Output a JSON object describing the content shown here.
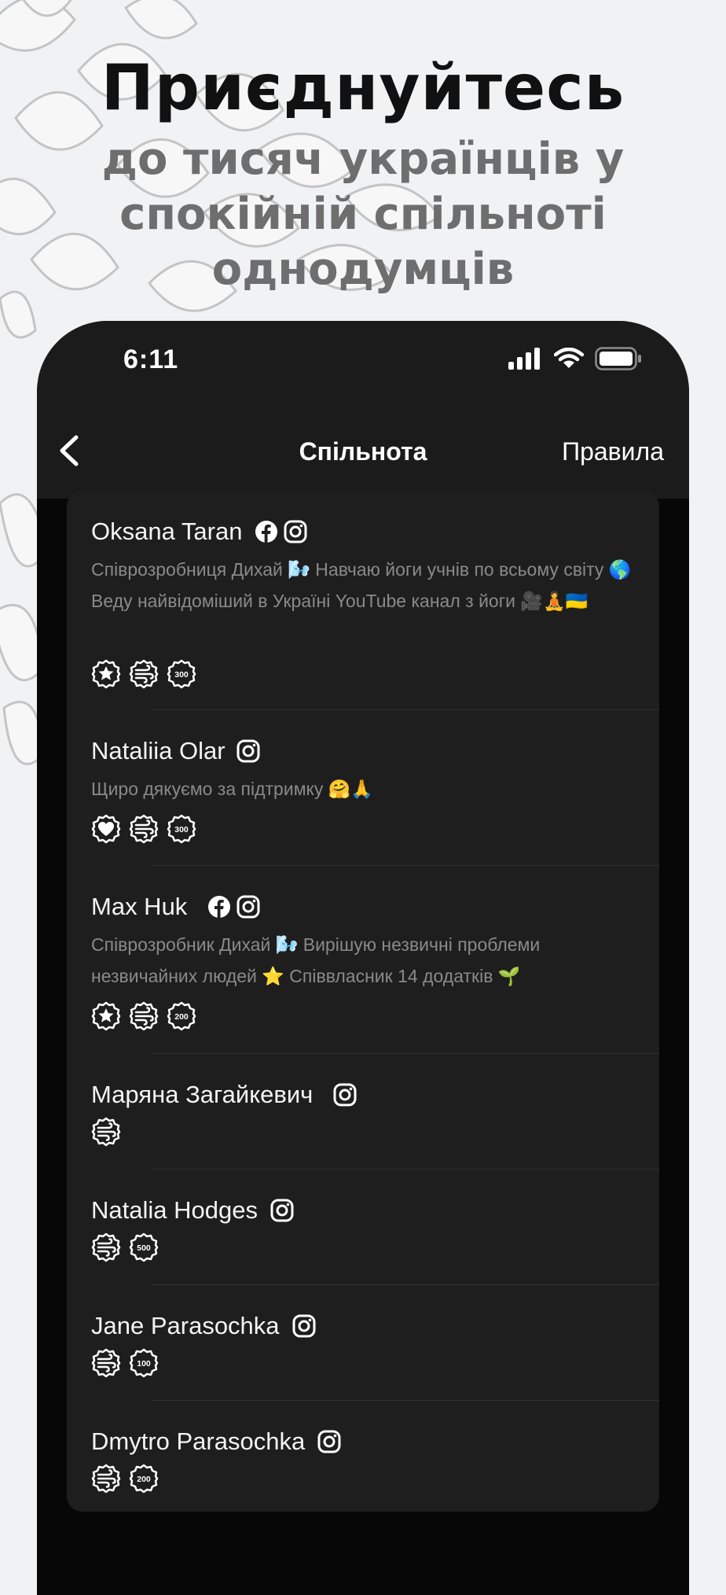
{
  "promo": {
    "title": "Приєднуйтесь",
    "subtitle": "до тисяч українців у спокійній спільноті однодумців"
  },
  "status_bar": {
    "time": "6:11",
    "icons": [
      "cellular-signal-icon",
      "wifi-icon",
      "battery-icon"
    ]
  },
  "nav": {
    "back_icon": "chevron-left-icon",
    "title": "Спільнота",
    "rules_label": "Правила"
  },
  "members": [
    {
      "name": "Oksana Taran",
      "socials": [
        "facebook",
        "instagram"
      ],
      "bio": "Співрозробниця Дихай 🌬️ Навчаю йоги учнів по всьому світу 🌎 Веду найвідоміший в Україні YouTube канал з йоги 🎥🧘🇺🇦",
      "badges": [
        "star",
        "wind",
        "300"
      ]
    },
    {
      "name": "Nataliia Olar",
      "socials": [
        "instagram"
      ],
      "bio": "Щиро дякуємо за підтримку 🤗🙏",
      "badges": [
        "heart",
        "wind",
        "300"
      ]
    },
    {
      "name": "Max Huk",
      "socials": [
        "facebook",
        "instagram"
      ],
      "bio": "Співрозробник Дихай 🌬️ Вирішую незвичні проблеми незвичайних людей ⭐ Співвласник 14 додатків 🌱",
      "badges": [
        "star",
        "wind",
        "200"
      ]
    },
    {
      "name": "Маряна Загайкевич",
      "socials": [
        "instagram"
      ],
      "bio": "",
      "badges": [
        "wind"
      ]
    },
    {
      "name": "Natalia Hodges",
      "socials": [
        "instagram"
      ],
      "bio": "",
      "badges": [
        "wind",
        "500"
      ]
    },
    {
      "name": "Jane Parasochka",
      "socials": [
        "instagram"
      ],
      "bio": "",
      "badges": [
        "wind",
        "100"
      ]
    },
    {
      "name": "Dmytro Parasochka",
      "socials": [
        "instagram"
      ],
      "bio": "",
      "badges": [
        "wind",
        "200"
      ]
    }
  ]
}
